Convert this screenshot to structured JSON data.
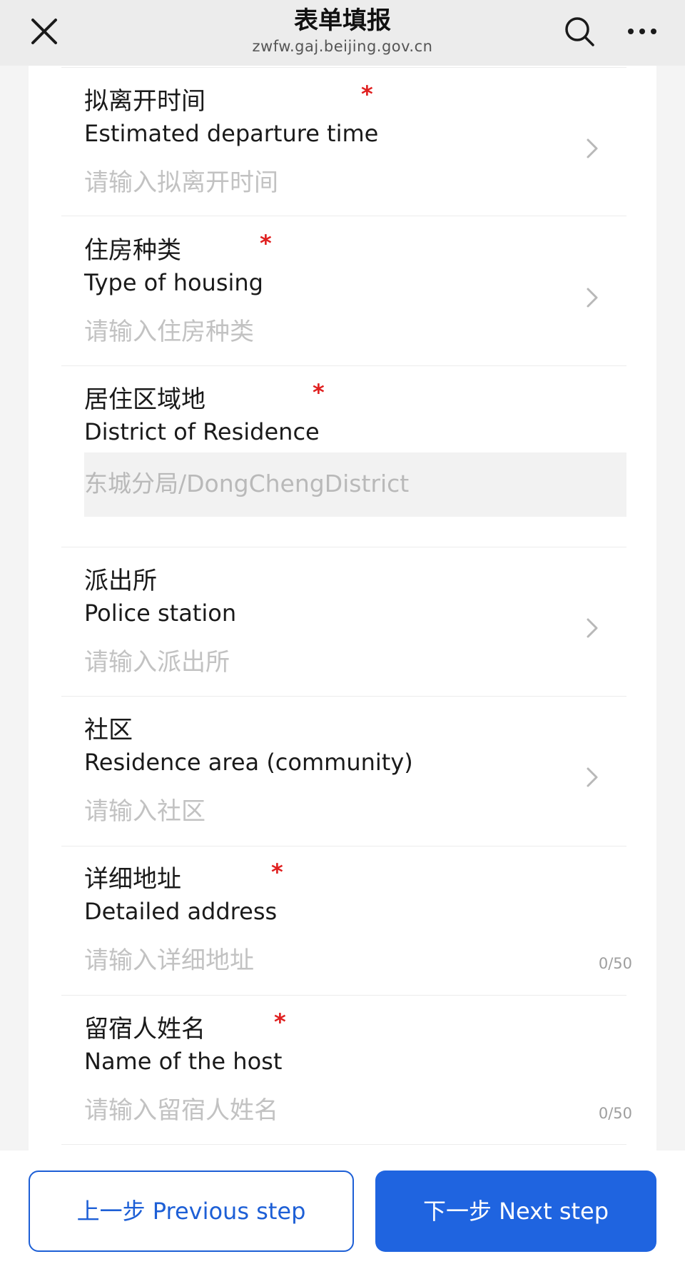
{
  "header": {
    "title": "表单填报",
    "domain": "zwfw.gaj.beijing.gov.cn",
    "close_icon": "close-icon",
    "search_icon": "search-icon",
    "more_icon": "more-icon"
  },
  "colors": {
    "accent": "#1f64e0",
    "required": "#e02020",
    "placeholder": "#c2c2c2"
  },
  "fields": [
    {
      "label_zh": "拟离开时间",
      "label_en": "Estimated departure time",
      "required": "*",
      "placeholder": "请输入拟离开时间",
      "control": "picker"
    },
    {
      "label_zh": "住房种类",
      "label_en": "Type of housing",
      "required": "*",
      "placeholder": "请输入住房种类",
      "control": "picker"
    },
    {
      "label_zh": "居住区域地",
      "label_en": "District of Residence",
      "required": "*",
      "value": "东城分局/DongChengDistrict",
      "control": "readonly"
    },
    {
      "label_zh": "派出所",
      "label_en": "Police station",
      "placeholder": "请输入派出所",
      "control": "picker"
    },
    {
      "label_zh": "社区",
      "label_en": "Residence area (community)",
      "placeholder": "请输入社区",
      "control": "picker"
    },
    {
      "label_zh": "详细地址",
      "label_en": "Detailed address",
      "required": "*",
      "placeholder": "请输入详细地址",
      "counter": "0/50",
      "control": "text"
    },
    {
      "label_zh": "留宿人姓名",
      "label_en": "Name of the host",
      "required": "*",
      "placeholder": "请输入留宿人姓名",
      "counter": "0/50",
      "control": "text"
    }
  ],
  "footer": {
    "prev_label": "上一步 Previous step",
    "next_label": "下一步 Next step"
  }
}
